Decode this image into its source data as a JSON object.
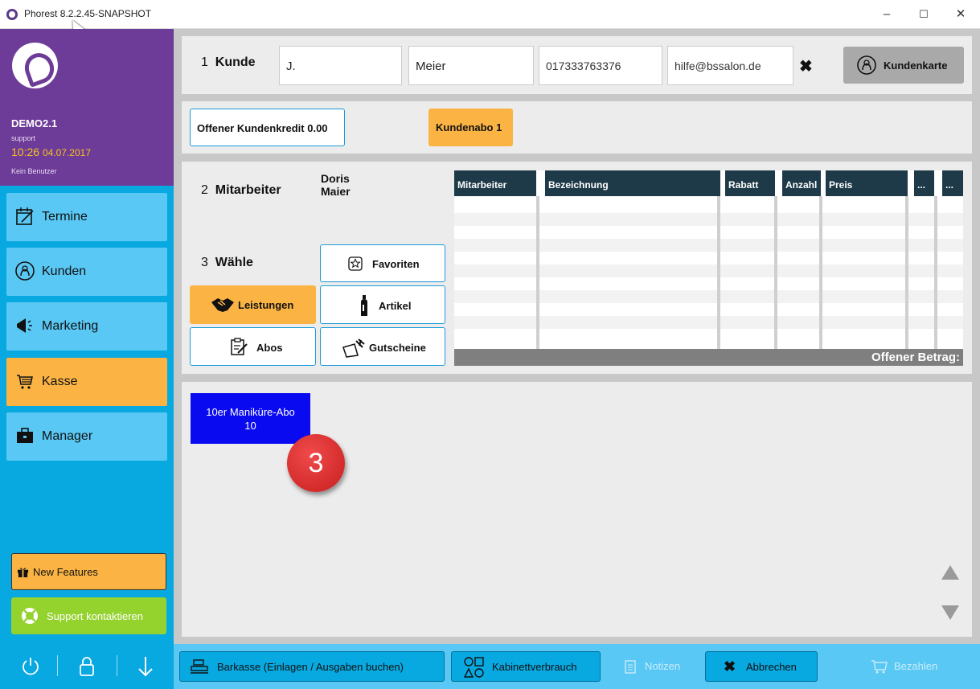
{
  "window": {
    "title": "Phorest 8.2.2.45-SNAPSHOT"
  },
  "sidebar": {
    "org": "DEMO2.1",
    "user": "support",
    "time": "10:26",
    "date": "04.07.2017",
    "no_user": "Kein Benutzer",
    "items": [
      {
        "label": "Termine",
        "icon": "calendar-edit-icon"
      },
      {
        "label": "Kunden",
        "icon": "face-icon"
      },
      {
        "label": "Marketing",
        "icon": "megaphone-icon"
      },
      {
        "label": "Kasse",
        "icon": "cart-icon",
        "active": true
      },
      {
        "label": "Manager",
        "icon": "briefcase-icon"
      }
    ],
    "new_features": "New Features",
    "support": "Support kontaktieren"
  },
  "customer": {
    "step_number": "1",
    "step_label": "Kunde",
    "first_name": "J.",
    "last_name": "Meier",
    "phone": "017333763376",
    "email": "hilfe@bssalon.de",
    "card_button": "Kundenkarte"
  },
  "credit": {
    "open_credit": "Offener Kundenkredit 0.00",
    "subscription": "Kundenabo 1"
  },
  "staff": {
    "step_number": "2",
    "step_label": "Mitarbeiter",
    "name_first": "Doris",
    "name_last": "Maier"
  },
  "choose": {
    "step_number": "3",
    "step_label": "Wähle",
    "buttons": {
      "favoriten": "Favoriten",
      "leistungen": "Leistungen",
      "artikel": "Artikel",
      "abos": "Abos",
      "gutscheine": "Gutscheine"
    }
  },
  "table": {
    "columns": [
      "Mitarbeiter",
      "Bezeichnung",
      "Rabatt",
      "Anzahl",
      "Preis",
      "...",
      "..."
    ],
    "footer": "Offener Betrag:"
  },
  "products": {
    "tile_name": "10er Maniküre-Abo",
    "tile_count": "10",
    "badge": "3"
  },
  "bottom": {
    "barkasse": "Barkasse (Einlagen / Ausgaben buchen)",
    "kabinett": "Kabinettverbrauch",
    "notizen": "Notizen",
    "abbrechen": "Abbrechen",
    "bezahlen": "Bezahlen"
  },
  "colors": {
    "sidebar_purple": "#6d3b98",
    "sidebar_blue": "#08a8e0",
    "nav_blue": "#5ac8f4",
    "orange": "#fbb444",
    "green": "#94d22e",
    "table_header": "#1e3a48",
    "tile_blue": "#0a0af0",
    "badge_red": "#d42a2a"
  }
}
